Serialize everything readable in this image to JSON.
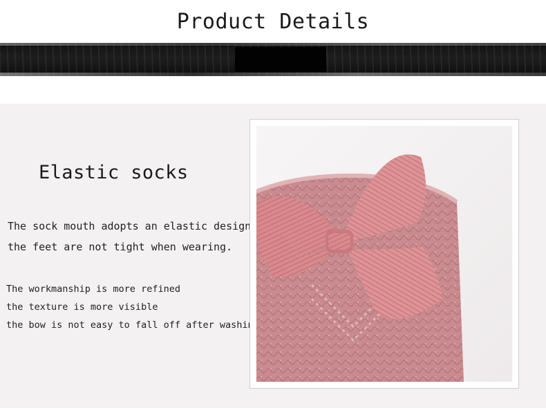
{
  "header": {
    "title": "Product Details"
  },
  "section": {
    "heading": "Elastic socks",
    "description_lines": [
      "The sock mouth adopts an elastic design",
      "the feet are not tight when wearing."
    ],
    "feature_lines": [
      "The workmanship is more refined",
      "the texture is more visible",
      "the bow is not easy to fall off after washing"
    ]
  },
  "photo": {
    "subject": "pink knit sock with ribbon bow",
    "colors": {
      "sock": "#cc8f93",
      "bow": "#d98a8e",
      "background": "#f7f5f6"
    }
  }
}
